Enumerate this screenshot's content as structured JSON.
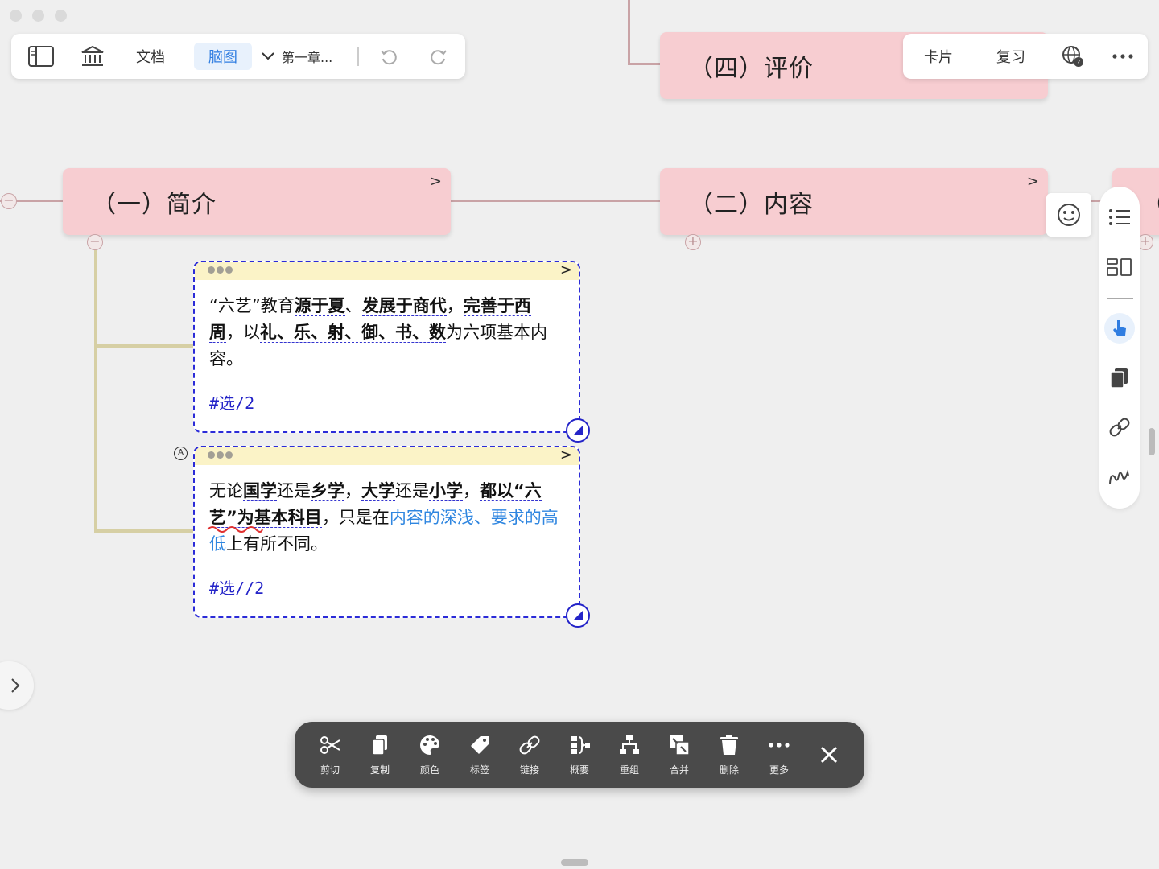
{
  "toolbar": {
    "doc_label": "文档",
    "mindmap_label": "脑图",
    "chapter_label": "第一章..."
  },
  "right_toolbar": {
    "card_label": "卡片",
    "review_label": "复习"
  },
  "topics": {
    "evaluation": "（四）评价",
    "intro": "（一）简介",
    "content": "（二）内容",
    "third_partial": "（三"
  },
  "card1": {
    "seg1": "“六艺”教育",
    "seg2": "源于夏",
    "seg3": "、",
    "seg4": "发展于商代",
    "seg5": "，",
    "seg6": "完善于西周",
    "seg7": "，以",
    "seg8": "礼、乐、射、御、书、数",
    "seg9": "为六项基本内容。",
    "tag": "#选/2"
  },
  "card2": {
    "seg1": "无论",
    "seg2": "国学",
    "seg3": "还是",
    "seg4": "乡学",
    "seg5": "，",
    "seg6": "大学",
    "seg7": "还是",
    "seg8": "小学",
    "seg9": "，",
    "seg10": "都以“六艺”为基本科目",
    "seg11": "，只是在",
    "seg12": "内容的深浅、要求的高低",
    "seg13": "上有所不同。",
    "tag": "#选//2"
  },
  "actions": {
    "cut": "剪切",
    "copy": "复制",
    "color": "颜色",
    "tag": "标签",
    "link": "链接",
    "summary": "概要",
    "regroup": "重组",
    "merge": "合并",
    "delete": "删除",
    "more": "更多"
  },
  "icons": {
    "sidebar": "sidebar-toggle-icon",
    "library": "library-icon",
    "undo": "undo-icon",
    "redo": "redo-icon",
    "web": "web-search-icon",
    "more": "more-icon",
    "emoji": "emoji-icon",
    "list": "list-icon",
    "layout": "layout-icon",
    "pointer": "pointer-icon",
    "pages": "pages-icon",
    "chain": "link-icon",
    "scribble": "scribble-icon",
    "close": "close-icon"
  },
  "colors": {
    "topic_fill": "#f7cdd1",
    "card_border": "#2b2bd8",
    "accent_blue": "#2f7de1",
    "action_bar": "#4a4a4a"
  }
}
